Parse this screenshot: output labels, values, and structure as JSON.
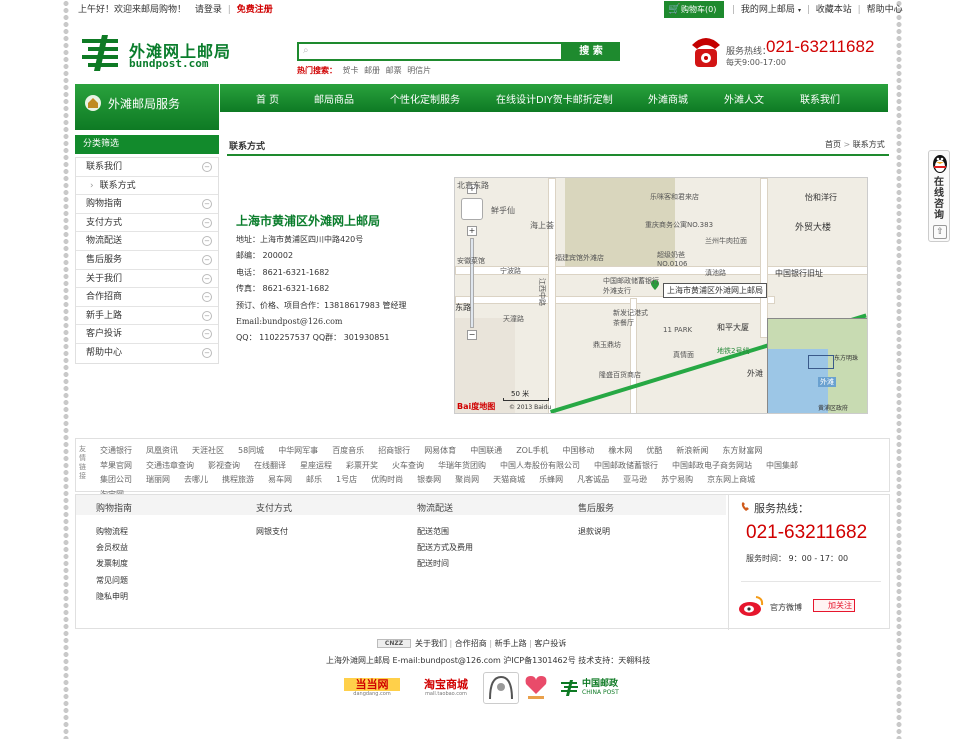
{
  "topbar": {
    "greeting": "上午好！欢迎来邮局购物！",
    "login": "请登录",
    "register": "免费注册",
    "cart": "购物车(0)",
    "my": "我的网上邮局",
    "bookmark": "收藏本站",
    "help": "帮助中心"
  },
  "logo": {
    "cn": "外滩网上邮局",
    "en": "bundpost.com"
  },
  "search": {
    "button": "搜 索",
    "hot_label": "热门搜索：",
    "hot": [
      "贺卡",
      "邮册",
      "邮票",
      "明信片"
    ]
  },
  "hotline": {
    "label": "服务热线：",
    "number": "021-63211682",
    "hours": "每天9:00-17:00"
  },
  "sidebar_title": "外滩邮局服务",
  "nav": [
    "首 页",
    "邮局商品",
    "个性化定制服务",
    "在线设计DIY贺卡邮折定制",
    "外滩商城",
    "外滩人文",
    "联系我们"
  ],
  "filter": {
    "title": "分类筛选",
    "items": [
      "联系我们",
      "联系方式",
      "购物指南",
      "支付方式",
      "物流配送",
      "售后服务",
      "关于我们",
      "合作招商",
      "新手上路",
      "客户投诉",
      "帮助中心"
    ]
  },
  "content": {
    "title": "联系方式",
    "breadcrumb_home": "首页",
    "breadcrumb_current": "联系方式"
  },
  "contact": {
    "company": "上海市黄浦区外滩网上邮局",
    "address": "地址：上海市黄浦区四川中路420号",
    "zip": "邮编： 200002",
    "phone": "电话： 8621-6321-1682",
    "fax": "传真： 8621-6321-1682",
    "booking": "预订、价格、项目合作：13818617983 管经理",
    "email": "Email:bundpost@126.com",
    "qq": "QQ： 1102257537 QQ群： 301930851"
  },
  "map": {
    "labels": [
      "北京东路",
      "鲜乎仙",
      "海上荟",
      "乐咪客和君来店",
      "怡和洋行",
      "外贸大楼",
      "重庆商务公寓NO.383",
      "兰州牛肉拉面",
      "超级奶爸NO.0106",
      "中国银行旧址",
      "宁波路",
      "滇池路",
      "安徽菜馆",
      "江西中路",
      "福建宾馆外滩店",
      "中国邮政储蓄银行外滩支行",
      "上海市黄浦区外滩网上邮局",
      "天潼路",
      "11 PARK",
      "和平大厦",
      "新发记港式茶餐厅",
      "鼎玉鼎坊",
      "真情面",
      "隆盛百货商店",
      "外滩",
      "地铁2号线",
      "东路",
      "天潼路",
      "50 米",
      "Bai度地图",
      "© 2013 Baidu",
      "东方明珠",
      "外滩",
      "黄浦区政府"
    ]
  },
  "links": {
    "label": "友情链接",
    "rows": [
      [
        "交通银行",
        "凤凰资讯",
        "天涯社区",
        "58同城",
        "中华网军事",
        "百度音乐",
        "招商银行",
        "网易体育",
        "中国联通",
        "ZOL手机",
        "中国移动",
        "橡木网",
        "优酷",
        "新浪新闻",
        "东方财富网"
      ],
      [
        "苹果官网",
        "交通违章查询",
        "影视查询",
        "在线翻译",
        "星座运程",
        "彩票开奖",
        "火车查询",
        "华瑞年货团购",
        "中国人寿股份有限公司",
        "中国邮政储蓄银行",
        "中国邮政电子商务网站",
        "中国集邮"
      ],
      [
        "集团公司",
        "瑞丽网",
        "去哪儿",
        "携程旅游",
        "易车网",
        "邮乐",
        "1号店",
        "优购时尚",
        "银泰网",
        "聚尚网",
        "天猫商城",
        "乐蜂网",
        "凡客诚品",
        "亚马逊",
        "苏宁易购",
        "京东网上商城"
      ],
      [
        "淘宝网"
      ]
    ]
  },
  "footer": {
    "cols": [
      {
        "title": "购物指南",
        "items": [
          "购物流程",
          "会员权益",
          "发票制度",
          "常见问题",
          "隐私申明"
        ]
      },
      {
        "title": "支付方式",
        "items": [
          "网银支付"
        ]
      },
      {
        "title": "物流配送",
        "items": [
          "配送范围",
          "配送方式及费用",
          "配送时间"
        ]
      },
      {
        "title": "售后服务",
        "items": [
          "退款说明"
        ]
      }
    ],
    "hotline_label": "服务热线：",
    "hotline": "021-63211682",
    "hours": "服务时间： 9：00 - 17：00",
    "weibo": "官方微博",
    "follow": "加关注"
  },
  "bottom": {
    "links": [
      "关于我们",
      "合作招商",
      "新手上路",
      "客户投诉"
    ],
    "cnzz": "CNZZ",
    "copyright": "上海外滩网上邮局 E-mail:bundpost@126.com 沪ICP备1301462号 技术支持：天翱科技",
    "logos": [
      "当当网",
      "淘宝商城",
      "中国邮政"
    ],
    "logos_sub": [
      "dangdang.com",
      "mall.taobao.com",
      "CHINA POST"
    ]
  },
  "float": {
    "label": "在线咨询"
  },
  "colors": {
    "primary_green": "#1e8a2e",
    "dark_green": "#0e7a24",
    "accent_red": "#d00000"
  }
}
